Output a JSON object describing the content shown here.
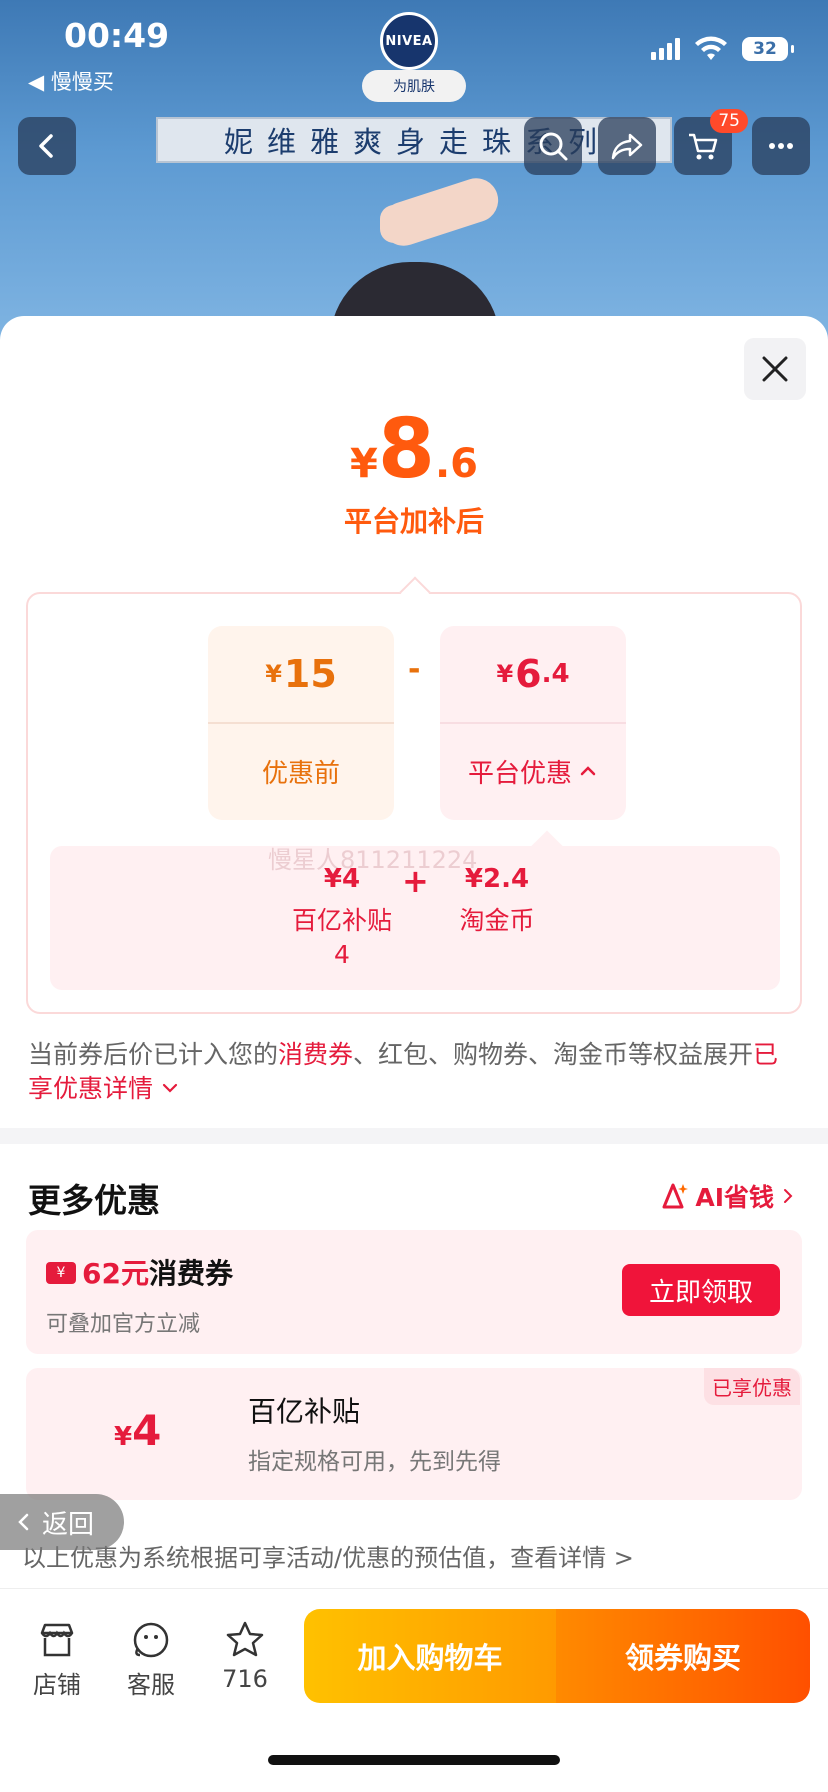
{
  "status_bar": {
    "time": "00:49",
    "back_app": "◀ 慢慢买",
    "battery": "32"
  },
  "banner": {
    "brand_logo": "NIVEA",
    "brand_tag": "为肌肤",
    "series_text": "妮维雅爽身走珠系列",
    "cart_badge": "75"
  },
  "icons": {
    "back": "chevron-left-icon",
    "search": "search-icon",
    "share": "share-icon",
    "cart": "cart-icon",
    "more": "more-icon",
    "close": "close-icon",
    "store": "store-icon",
    "service": "service-icon",
    "star": "star-icon"
  },
  "price": {
    "currency": "¥",
    "integer": "8",
    "decimal": ".6",
    "label": "平台加补后"
  },
  "calc": {
    "before": {
      "currency": "¥",
      "integer": "15",
      "decimal": "",
      "label": "优惠前"
    },
    "minus": "-",
    "platform": {
      "currency": "¥",
      "integer": "6",
      "decimal": ".4",
      "label": "平台优惠"
    },
    "watermark": "慢星人811211224",
    "breakdown": [
      {
        "value": "¥4",
        "label": "百亿补贴",
        "sub": "4"
      },
      {
        "value": "¥2.4",
        "label": "淘金币",
        "sub": ""
      }
    ],
    "plus": "+"
  },
  "note": {
    "part1": "当前券后价已计入您的",
    "red1": "消费券",
    "part2": "、红包、购物券、淘金币等权益展开",
    "red2": "已享优惠详情"
  },
  "more": {
    "title": "更多优惠",
    "ai_link": "AI省钱"
  },
  "coupon": {
    "amount": "62元",
    "name": "消费券",
    "desc": "可叠加官方立减",
    "button": "立即领取"
  },
  "subsidy": {
    "currency": "¥",
    "amount": "4",
    "title": "百亿补贴",
    "desc": "指定规格可用，先到先得",
    "tag": "已享优惠"
  },
  "footer_note": "以上优惠为系统根据可享活动/优惠的预估值，查看详情 >",
  "back_float": "返回",
  "bottom_bar": {
    "store": "店铺",
    "service": "客服",
    "favorites": "716",
    "add_cart": "加入购物车",
    "buy": "领券购买"
  },
  "colors": {
    "accent_orange": "#ff5a0e",
    "accent_red": "#e51b3c"
  }
}
